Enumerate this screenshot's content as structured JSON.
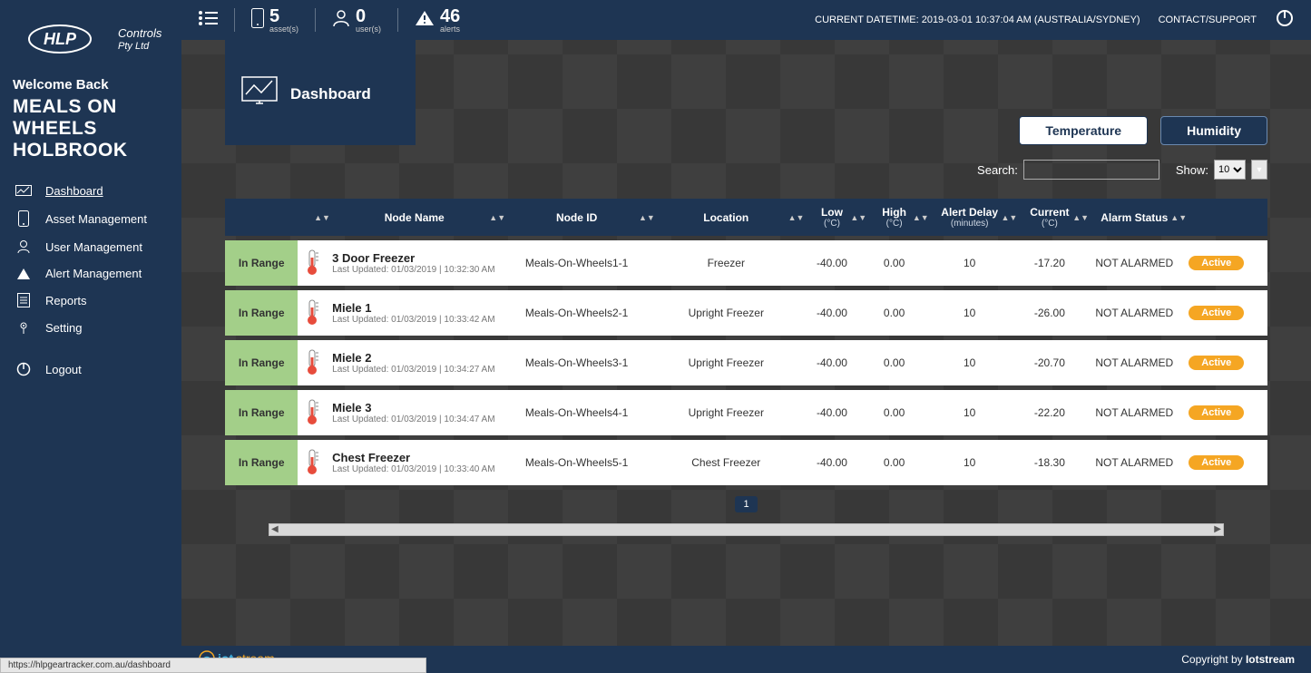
{
  "brand": {
    "name": "HLP Controls Pty Ltd"
  },
  "welcome_label": "Welcome Back",
  "org_name": "MEALS ON WHEELS HOLBROOK",
  "nav": {
    "items": [
      "Dashboard",
      "Asset Management",
      "User Management",
      "Alert Management",
      "Reports",
      "Setting"
    ],
    "logout": "Logout"
  },
  "topbar": {
    "asset_count": "5",
    "asset_label": "asset(s)",
    "user_count": "0",
    "user_label": "user(s)",
    "alert_count": "46",
    "alert_label": "alerts",
    "datetime_label": "CURRENT DATETIME:",
    "datetime_value": "2019-03-01 10:37:04 AM (AUSTRALIA/SYDNEY)",
    "contact": "CONTACT/SUPPORT"
  },
  "dash_tab": "Dashboard",
  "toggle": {
    "temperature": "Temperature",
    "humidity": "Humidity"
  },
  "filters": {
    "search_label": "Search:",
    "show_label": "Show:",
    "show_value": "10"
  },
  "columns": {
    "blank": "",
    "node_name": "Node Name",
    "node_id": "Node ID",
    "location": "Location",
    "low": "Low",
    "low_unit": "(°C)",
    "high": "High",
    "high_unit": "(°C)",
    "alert_delay": "Alert Delay",
    "alert_delay_unit": "(minutes)",
    "current": "Current",
    "current_unit": "(°C)",
    "alarm_status": "Alarm Status"
  },
  "rows": [
    {
      "status": "In Range",
      "name": "3 Door Freezer",
      "updated": "Last Updated: 01/03/2019 | 10:32:30 AM",
      "node_id": "Meals-On-Wheels1-1",
      "location": "Freezer",
      "low": "-40.00",
      "high": "0.00",
      "delay": "10",
      "current": "-17.20",
      "alarm": "NOT ALARMED",
      "badge": "Active"
    },
    {
      "status": "In Range",
      "name": "Miele 1",
      "updated": "Last Updated: 01/03/2019 | 10:33:42 AM",
      "node_id": "Meals-On-Wheels2-1",
      "location": "Upright Freezer",
      "low": "-40.00",
      "high": "0.00",
      "delay": "10",
      "current": "-26.00",
      "alarm": "NOT ALARMED",
      "badge": "Active"
    },
    {
      "status": "In Range",
      "name": "Miele 2",
      "updated": "Last Updated: 01/03/2019 | 10:34:27 AM",
      "node_id": "Meals-On-Wheels3-1",
      "location": "Upright Freezer",
      "low": "-40.00",
      "high": "0.00",
      "delay": "10",
      "current": "-20.70",
      "alarm": "NOT ALARMED",
      "badge": "Active"
    },
    {
      "status": "In Range",
      "name": "Miele 3",
      "updated": "Last Updated: 01/03/2019 | 10:34:47 AM",
      "node_id": "Meals-On-Wheels4-1",
      "location": "Upright Freezer",
      "low": "-40.00",
      "high": "0.00",
      "delay": "10",
      "current": "-22.20",
      "alarm": "NOT ALARMED",
      "badge": "Active"
    },
    {
      "status": "In Range",
      "name": "Chest Freezer",
      "updated": "Last Updated: 01/03/2019 | 10:33:40 AM",
      "node_id": "Meals-On-Wheels5-1",
      "location": "Chest Freezer",
      "low": "-40.00",
      "high": "0.00",
      "delay": "10",
      "current": "-18.30",
      "alarm": "NOT ALARMED",
      "badge": "Active"
    }
  ],
  "page": "1",
  "footer_brand": "iotstream",
  "copyright_prefix": "Copyright by ",
  "copyright_name": "Iotstream",
  "status_url": "https://hlpgeartracker.com.au/dashboard"
}
